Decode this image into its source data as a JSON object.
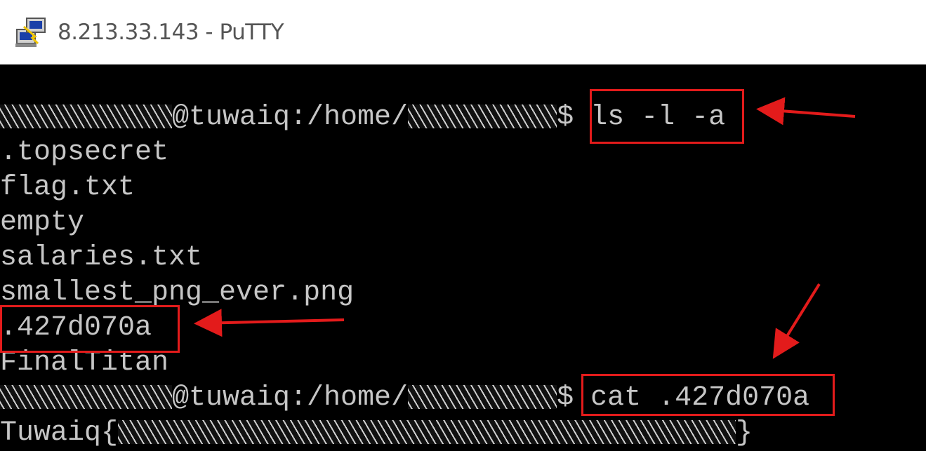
{
  "window": {
    "title": "8.213.33.143 - PuTTY",
    "app_icon": "putty-icon"
  },
  "terminal": {
    "prompt1": {
      "host": "@tuwaiq:/home/",
      "dollar": "$",
      "command": "ls -l -a"
    },
    "listing": [
      ".topsecret",
      "flag.txt",
      "empty",
      "salaries.txt",
      "smallest_png_ever.png",
      ".427d070a",
      "FinalTitan"
    ],
    "prompt2": {
      "host": "@tuwaiq:/home/",
      "dollar": "$",
      "command": "cat .427d070a"
    },
    "output": {
      "prefix": "Tuwaiq{",
      "suffix": "}"
    }
  },
  "colors": {
    "highlight": "#e31b1b",
    "text": "#c6c6c6",
    "background": "#000000"
  }
}
